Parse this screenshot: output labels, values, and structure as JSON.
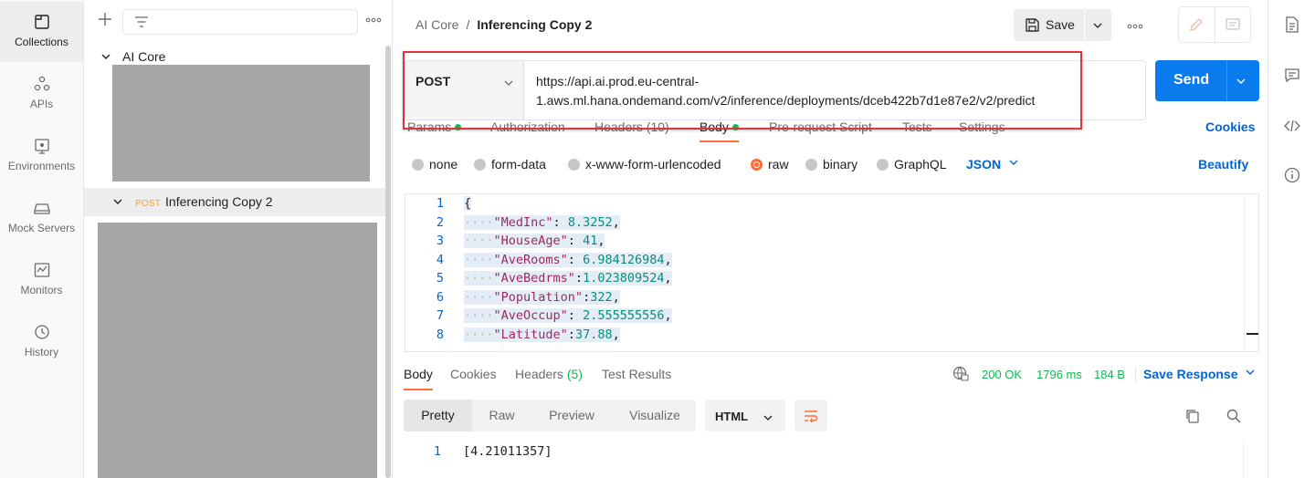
{
  "nav": {
    "items": [
      {
        "label": "Collections",
        "icon": "collections-icon"
      },
      {
        "label": "APIs",
        "icon": "apis-icon"
      },
      {
        "label": "Environments",
        "icon": "environments-icon"
      },
      {
        "label": "Mock Servers",
        "icon": "mock-servers-icon"
      },
      {
        "label": "Monitors",
        "icon": "monitors-icon"
      },
      {
        "label": "History",
        "icon": "history-icon"
      }
    ]
  },
  "sidebar": {
    "tree": [
      {
        "name": "AI Core"
      },
      {
        "method": "POST",
        "name": "Inferencing Copy 2"
      }
    ]
  },
  "header": {
    "breadcrumb_parent": "AI Core",
    "breadcrumb_sep": "/",
    "breadcrumb_current": "Inferencing Copy 2",
    "save_label": "Save"
  },
  "request": {
    "method": "POST",
    "url_line1": "https://api.ai.prod.eu-central-",
    "url_line2": "1.aws.ml.hana.ondemand.com/v2/inference/deployments/dceb422b7d1e87e2/v2/predict",
    "send_label": "Send",
    "cookies_label": "Cookies",
    "tabs": [
      {
        "label": "Params",
        "dot": true
      },
      {
        "label": "Authorization"
      },
      {
        "label": "Headers",
        "count": "(10)"
      },
      {
        "label": "Body",
        "dot": true
      },
      {
        "label": "Pre-request Script"
      },
      {
        "label": "Tests"
      },
      {
        "label": "Settings"
      }
    ],
    "body_types": [
      "none",
      "form-data",
      "x-www-form-urlencoded",
      "raw",
      "binary",
      "GraphQL"
    ],
    "body_type_selected": "raw",
    "language": "JSON",
    "beautify_label": "Beautify",
    "code_lines": [
      {
        "n": "1",
        "text": "{"
      },
      {
        "n": "2",
        "key": "\"MedInc\"",
        "sep": ": ",
        "val": "8.3252",
        "end": ","
      },
      {
        "n": "3",
        "key": "\"HouseAge\"",
        "sep": ": ",
        "val": "41",
        "end": ","
      },
      {
        "n": "4",
        "key": "\"AveRooms\"",
        "sep": ": ",
        "val": "6.984126984",
        "end": ","
      },
      {
        "n": "5",
        "key": "\"AveBedrms\"",
        "sep": ":",
        "val": "1.023809524",
        "end": ","
      },
      {
        "n": "6",
        "key": "\"Population\"",
        "sep": ":",
        "val": "322",
        "end": ","
      },
      {
        "n": "7",
        "key": "\"AveOccup\"",
        "sep": ": ",
        "val": "2.555555556",
        "end": ","
      },
      {
        "n": "8",
        "key": "\"Latitude\"",
        "sep": ":",
        "val": "37.88",
        "end": ","
      }
    ]
  },
  "response": {
    "tabs": [
      {
        "label": "Body"
      },
      {
        "label": "Cookies"
      },
      {
        "label": "Headers",
        "count": "(5)"
      },
      {
        "label": "Test Results"
      }
    ],
    "status": "200 OK",
    "time": "1796 ms",
    "size": "184 B",
    "save_label": "Save Response",
    "views": [
      "Pretty",
      "Raw",
      "Preview",
      "Visualize"
    ],
    "format": "HTML",
    "line_number": "1",
    "line_text": "[4.21011357]"
  },
  "colors": {
    "accent": "#ff6c37",
    "primary": "#097bed",
    "link": "#0265d2",
    "success": "#0cbb52",
    "highlight_box": "#d9363e"
  }
}
